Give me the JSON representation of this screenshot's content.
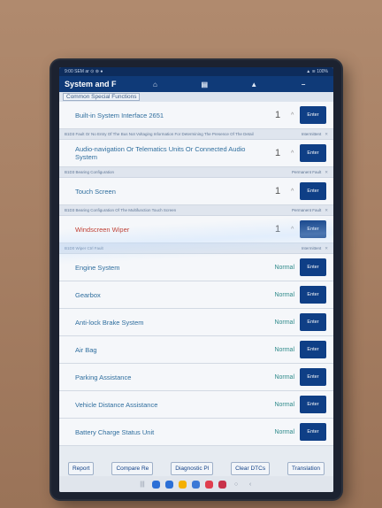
{
  "statusbar": {
    "left": "9:00 SEM ar ⊙ ⊚ ●",
    "right": "▲ ≋ 100%"
  },
  "header": {
    "title": "System and F",
    "icons": [
      "home-icon",
      "document-icon",
      "person-icon",
      "more-icon"
    ]
  },
  "subtitle": "Common Special Functions",
  "rows": [
    {
      "label": "Built-in System Interface 2651",
      "num": "1",
      "status": "",
      "enter": "Enter",
      "warn": false,
      "desc": "B1D3 Fault Or No Entry Of The Bus Not Voltaging Information For Determining The Presence Of The Detail",
      "note": "Intermittent"
    },
    {
      "label": "Audio-navigation Or Telematics Units Or Connected Audio System",
      "num": "1",
      "status": "",
      "enter": "Enter",
      "warn": false,
      "desc": "B1D3 Bearing Configuration",
      "note": "Permanent Fault"
    },
    {
      "label": "Touch Screen",
      "num": "1",
      "status": "",
      "enter": "Enter",
      "warn": false,
      "desc": "B1D3 Bearing Configuration Of The Multifunction Touch Screen",
      "note": "Permanent Fault"
    },
    {
      "label": "Windscreen Wiper",
      "num": "1",
      "status": "",
      "enter": "Enter",
      "warn": true,
      "desc": "B1D0 Wiper Ctrl Fault",
      "note": "Intermittent"
    },
    {
      "label": "Engine System",
      "num": "",
      "status": "Normal",
      "enter": "Enter",
      "warn": false
    },
    {
      "label": "Gearbox",
      "num": "",
      "status": "Normal",
      "enter": "Enter",
      "warn": false
    },
    {
      "label": "Anti-lock Brake System",
      "num": "",
      "status": "Normal",
      "enter": "Enter",
      "warn": false
    },
    {
      "label": "Air Bag",
      "num": "",
      "status": "Normal",
      "enter": "Enter",
      "warn": false
    },
    {
      "label": "Parking Assistance",
      "num": "",
      "status": "Normal",
      "enter": "Enter",
      "warn": false
    },
    {
      "label": "Vehicle Distance Assistance",
      "num": "",
      "status": "Normal",
      "enter": "Enter",
      "warn": false
    },
    {
      "label": "Battery Charge Status Unit",
      "num": "",
      "status": "Normal",
      "enter": "Enter",
      "warn": false
    }
  ],
  "toolbar": [
    "Report",
    "Compare Re",
    "Diagnostic Pl",
    "Clear DTCs",
    "Translation"
  ],
  "dock": [
    {
      "icon": "phone-app-icon",
      "color": "#2b6fd6"
    },
    {
      "icon": "camera-app-icon",
      "color": "#2b6fd6"
    },
    {
      "icon": "store-app-icon",
      "color": "#f4b000"
    },
    {
      "icon": "browser-app-icon",
      "color": "#3b79d6"
    },
    {
      "icon": "messages-app-icon",
      "color": "#e03e4e"
    },
    {
      "icon": "gallery-app-icon",
      "color": "#c8324a"
    }
  ],
  "navkeys": [
    "|||",
    "○",
    "‹"
  ]
}
